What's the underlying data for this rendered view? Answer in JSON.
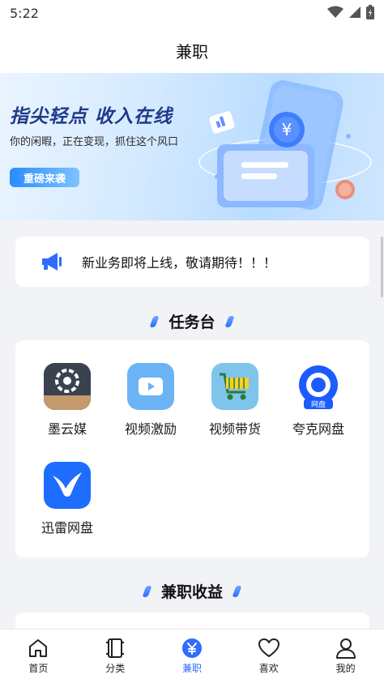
{
  "status_bar": {
    "time": "5:22"
  },
  "header": {
    "title": "兼职"
  },
  "banner": {
    "headline": "指尖轻点  收入在线",
    "subtitle": "你的闲暇，正在变现，抓住这个风口",
    "button": "重磅来袭",
    "currency_symbol": "¥"
  },
  "notice": {
    "text": "新业务即将上线，敬请期待！！！"
  },
  "task_section": {
    "title": "任务台",
    "items": [
      {
        "label": "墨云媒"
      },
      {
        "label": "视频激励"
      },
      {
        "label": "视频带货"
      },
      {
        "label": "夸克网盘",
        "badge": "网盘"
      },
      {
        "label": "迅雷网盘"
      }
    ]
  },
  "earnings_section": {
    "title": "兼职收益"
  },
  "tabs": [
    {
      "label": "首页",
      "icon": "home-icon"
    },
    {
      "label": "分类",
      "icon": "category-icon"
    },
    {
      "label": "兼职",
      "icon": "yen-icon",
      "active": true
    },
    {
      "label": "喜欢",
      "icon": "heart-icon"
    },
    {
      "label": "我的",
      "icon": "user-icon"
    }
  ],
  "colors": {
    "accent": "#2f6bff",
    "background": "#f2f3f6"
  }
}
